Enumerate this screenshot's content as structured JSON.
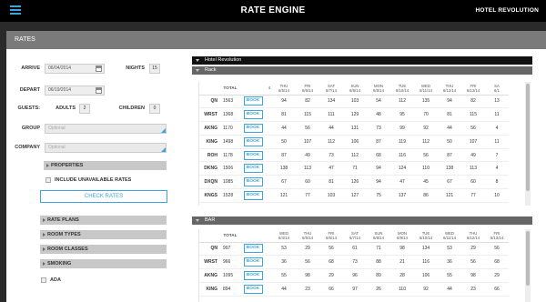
{
  "header": {
    "app_title": "RATE ENGINE",
    "hotel": "HOTEL REVOLUTION"
  },
  "page": {
    "title": "RATES"
  },
  "form": {
    "arrive_label": "ARRIVE",
    "arrive_value": "06/04/2014",
    "nights_label": "NIGHTS",
    "nights_value": "15",
    "depart_label": "DEPART",
    "depart_value": "06/19/2014",
    "guests_label": "GUESTS:",
    "adults_label": "ADULTS",
    "adults_value": "2",
    "children_label": "CHILDREN",
    "children_value": "0",
    "group_label": "GROUP",
    "group_placeholder": "Optional",
    "company_label": "COMPANY",
    "company_placeholder": "Optional",
    "properties_label": "PROPERTIES",
    "include_unavailable_label": "INCLUDE UNAVAILABLE RATES",
    "check_rates_label": "CHECK RATES",
    "rate_plans_label": "RATE PLANS",
    "room_types_label": "ROOM TYPES",
    "room_classes_label": "ROOM CLASSES",
    "smoking_label": "SMOKING",
    "ada_label": "ADA"
  },
  "results": {
    "property_header": "Hotel Revolution",
    "rack": {
      "title": "Rack",
      "total_label": "TOTAL",
      "extra_header": "4",
      "days": [
        {
          "dow": "THU",
          "date": "6/5/14"
        },
        {
          "dow": "FRI",
          "date": "6/6/14"
        },
        {
          "dow": "SAT",
          "date": "6/7/14"
        },
        {
          "dow": "SUN",
          "date": "6/8/14"
        },
        {
          "dow": "MON",
          "date": "6/9/14"
        },
        {
          "dow": "TUE",
          "date": "6/10/14"
        },
        {
          "dow": "WED",
          "date": "6/11/14"
        },
        {
          "dow": "THU",
          "date": "6/12/14"
        },
        {
          "dow": "FRI",
          "date": "6/13/14"
        },
        {
          "dow": "SA",
          "date": "6/1"
        }
      ],
      "rows": [
        {
          "code": "QN",
          "total": "1563",
          "book": "BOOK",
          "values": [
            "94",
            "82",
            "134",
            "103",
            "54",
            "112",
            "135",
            "94",
            "82",
            "13"
          ]
        },
        {
          "code": "WRST",
          "total": "1368",
          "book": "BOOK",
          "values": [
            "81",
            "115",
            "111",
            "129",
            "48",
            "95",
            "70",
            "81",
            "115",
            "11"
          ]
        },
        {
          "code": "AKNG",
          "total": "1170",
          "book": "BOOK",
          "values": [
            "44",
            "56",
            "44",
            "131",
            "73",
            "99",
            "92",
            "44",
            "56",
            "4"
          ]
        },
        {
          "code": "KING",
          "total": "1498",
          "book": "BOOK",
          "values": [
            "50",
            "107",
            "112",
            "106",
            "87",
            "119",
            "112",
            "50",
            "107",
            "11"
          ]
        },
        {
          "code": "ROH",
          "total": "1178",
          "book": "BOOK",
          "values": [
            "87",
            "49",
            "73",
            "112",
            "68",
            "116",
            "56",
            "87",
            "49",
            "7"
          ]
        },
        {
          "code": "DKNG",
          "total": "1506",
          "book": "BOOK",
          "values": [
            "138",
            "113",
            "47",
            "71",
            "94",
            "124",
            "110",
            "138",
            "113",
            "4"
          ]
        },
        {
          "code": "DXQN",
          "total": "1085",
          "book": "BOOK",
          "values": [
            "67",
            "60",
            "81",
            "126",
            "94",
            "47",
            "45",
            "67",
            "60",
            "8"
          ]
        },
        {
          "code": "KNGS",
          "total": "1528",
          "book": "BOOK",
          "values": [
            "121",
            "77",
            "103",
            "127",
            "75",
            "137",
            "86",
            "121",
            "77",
            "10"
          ]
        }
      ]
    },
    "bar": {
      "title": "BAR",
      "total_label": "TOTAL",
      "days": [
        {
          "dow": "WED",
          "date": "6/4/14"
        },
        {
          "dow": "THU",
          "date": "6/5/14"
        },
        {
          "dow": "FRI",
          "date": "6/6/14"
        },
        {
          "dow": "SAT",
          "date": "6/7/14"
        },
        {
          "dow": "SUN",
          "date": "6/8/14"
        },
        {
          "dow": "MON",
          "date": "6/9/14"
        },
        {
          "dow": "TUE",
          "date": "6/10/14"
        },
        {
          "dow": "WED",
          "date": "6/11/14"
        },
        {
          "dow": "THU",
          "date": "6/12/14"
        },
        {
          "dow": "FRI",
          "date": "6/13/14"
        }
      ],
      "rows": [
        {
          "code": "QN",
          "total": "997",
          "book": "BOOK",
          "values": [
            "53",
            "29",
            "56",
            "61",
            "71",
            "98",
            "134",
            "53",
            "29",
            "56"
          ]
        },
        {
          "code": "WRST",
          "total": "966",
          "book": "BOOK",
          "values": [
            "36",
            "56",
            "68",
            "73",
            "88",
            "21",
            "116",
            "36",
            "56",
            "68"
          ]
        },
        {
          "code": "AKNG",
          "total": "1095",
          "book": "BOOK",
          "values": [
            "55",
            "98",
            "29",
            "96",
            "89",
            "28",
            "106",
            "55",
            "98",
            "29"
          ]
        },
        {
          "code": "KING",
          "total": "894",
          "book": "BOOK",
          "values": [
            "44",
            "23",
            "66",
            "97",
            "26",
            "110",
            "92",
            "44",
            "23",
            "66"
          ]
        }
      ]
    }
  },
  "colors": {
    "accent": "#3aa6dd",
    "topbar": "#000000",
    "frame": "#2a2a2a",
    "rates_bar": "#7a7a7a"
  }
}
